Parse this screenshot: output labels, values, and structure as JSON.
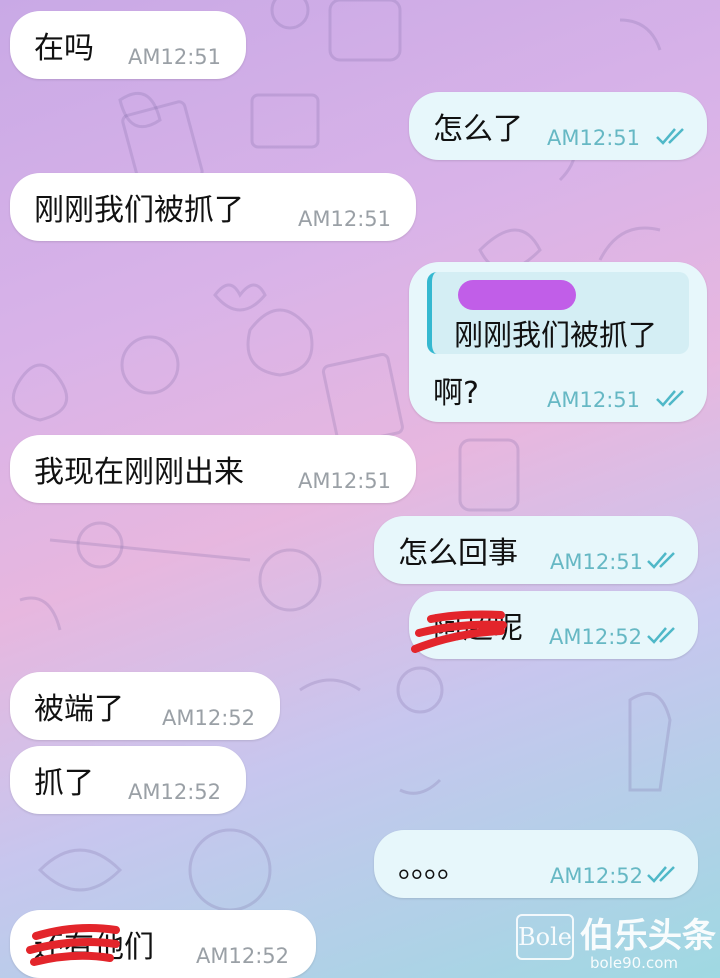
{
  "chat": {
    "messages": [
      {
        "text": "在吗",
        "time": "AM12:51"
      },
      {
        "text": "怎么了",
        "time": "AM12:51"
      },
      {
        "text": "刚刚我们被抓了",
        "time": "AM12:51"
      },
      {
        "quote": "刚刚我们被抓了",
        "text": "啊?",
        "time": "AM12:51"
      },
      {
        "text": "我现在刚刚出来",
        "time": "AM12:51"
      },
      {
        "text": "怎么回事",
        "time": "AM12:51"
      },
      {
        "text": "阿超呢",
        "time": "AM12:52"
      },
      {
        "text": "被端了",
        "time": "AM12:52"
      },
      {
        "text": "抓了",
        "time": "AM12:52"
      },
      {
        "text": "。。。。",
        "time": "AM12:52"
      },
      {
        "text": "还有他们",
        "time": "AM12:52"
      }
    ]
  },
  "watermark": {
    "box": "Bole",
    "name": "伯乐头条",
    "url": "bole90.com"
  },
  "colors": {
    "incoming": "#ffffff",
    "outgoing": "#e7f7fb",
    "check": "#4fb8c8",
    "quote_bar": "#35b8d0",
    "redact_red": "#e3252b",
    "redact_purple": "#c15ee8"
  }
}
